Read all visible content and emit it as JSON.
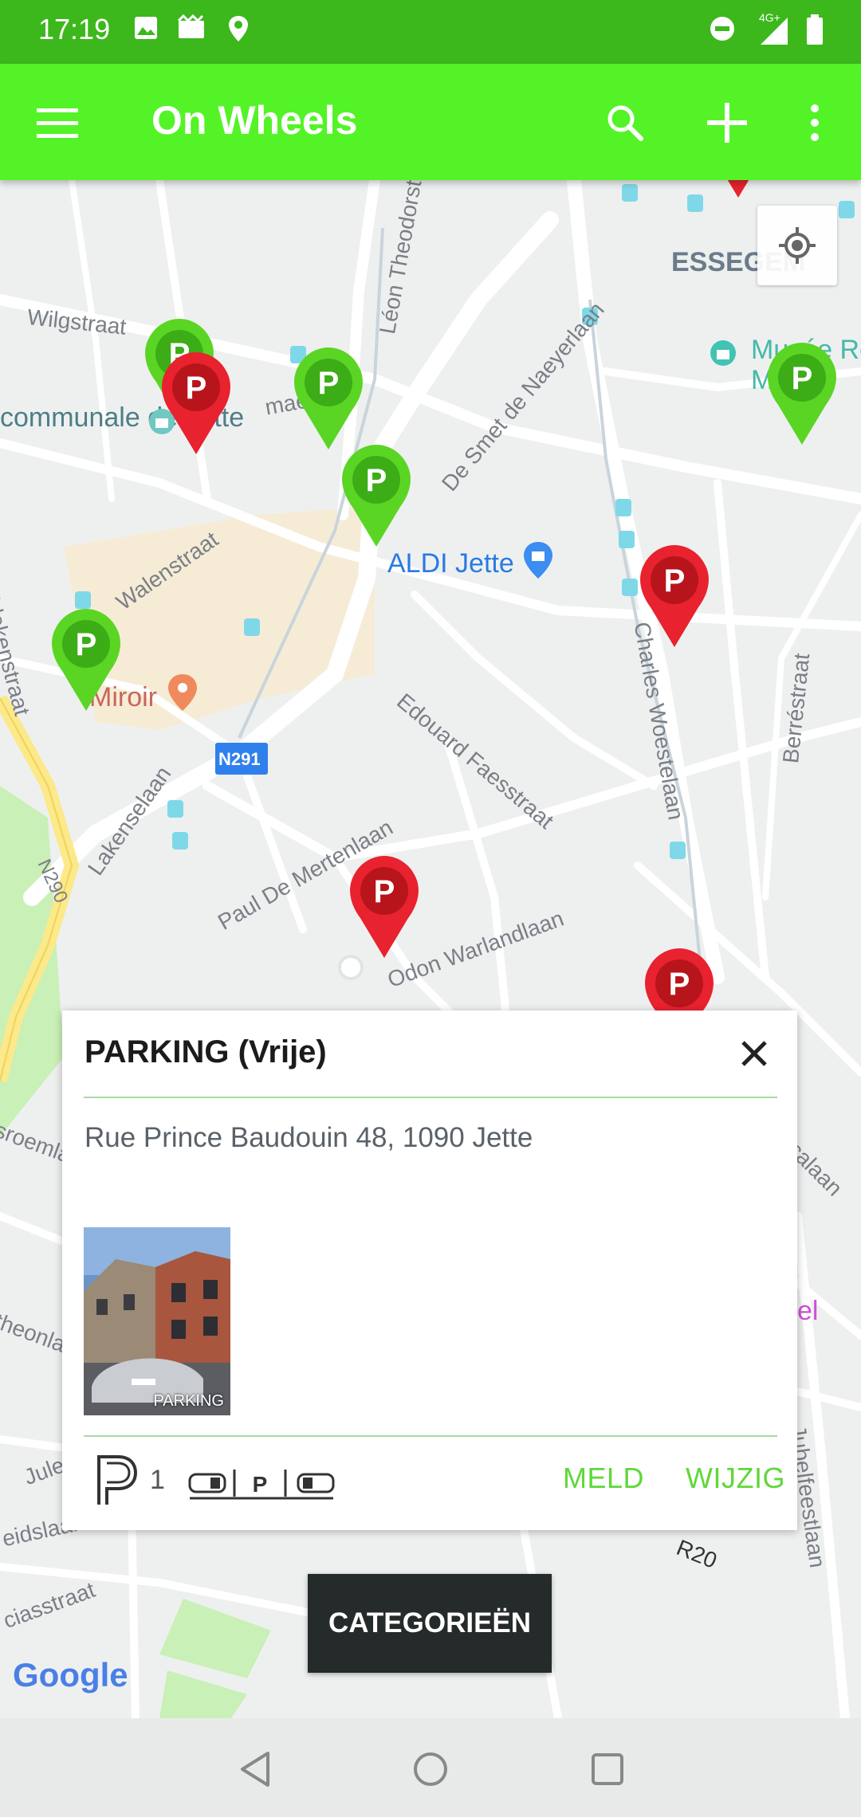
{
  "status_bar": {
    "time": "17:19",
    "network": "4G+"
  },
  "app_bar": {
    "title": "On Wheels",
    "icons": [
      "menu-icon",
      "search-icon",
      "add-icon",
      "more-vert-icon"
    ]
  },
  "map": {
    "street_labels": [
      "Wilgstraat",
      "Léon Theodorstraat",
      "De Smet de Naeyerlaan",
      "Walenstraat",
      "Edouard Faesstraat",
      "Charles Woestelaan",
      "Berréstraat",
      "Lakenselaan",
      "Paul De Mertenlaan",
      "Odon Warlandlaan",
      "N291",
      "N290",
      "maestr",
      "idekenstraat",
      "sroemlaa",
      "theonla",
      "Jules",
      "eidslaan",
      "ciasstraat",
      "icalaan",
      "Jubelfeestlaan",
      "R20"
    ],
    "poi_labels": [
      "communale de Jette",
      "ALDI Jette",
      "Miroir",
      "ESSEGEM",
      "Musée Re",
      "M m",
      "el"
    ],
    "marker_letter": "P",
    "colors": {
      "free_parking": "#5ad524",
      "paid_parking": "#e8222e"
    }
  },
  "card": {
    "title": "PARKING (Vrije)",
    "address": "Rue Prince Baudouin 48, 1090 Jette",
    "photo_caption": "PARKING",
    "parking_count": "1",
    "actions": {
      "report": "MELD",
      "edit": "WIJZIG"
    }
  },
  "categories_button": "CATEGORIEËN",
  "google_logo": "Google",
  "nav_icons": [
    "back-icon",
    "home-icon",
    "recents-icon"
  ]
}
